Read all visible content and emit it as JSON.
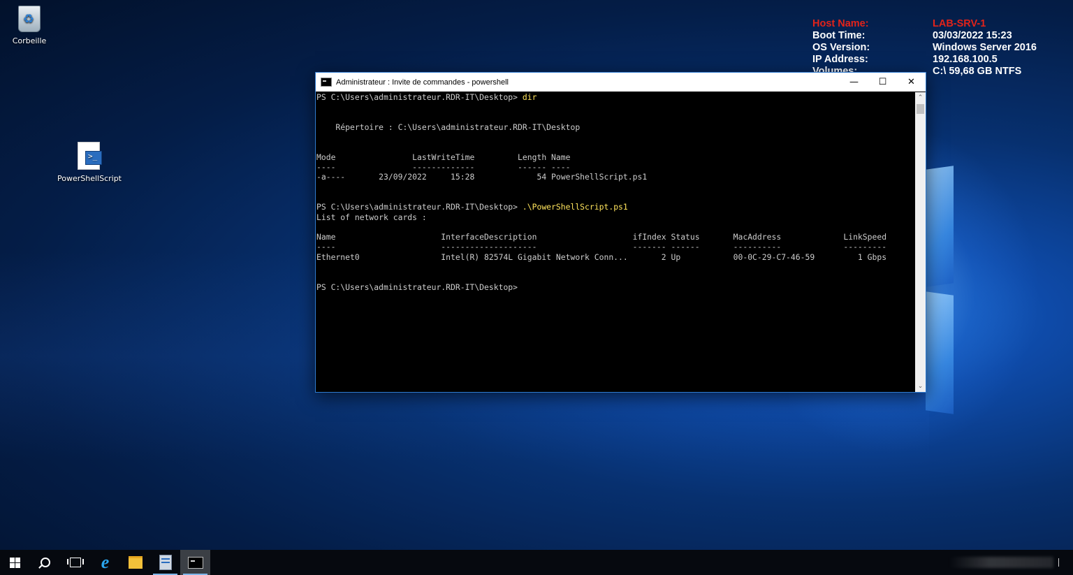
{
  "desktop": {
    "icons": [
      {
        "label": "Corbeille",
        "icon": "recycle-bin-icon"
      },
      {
        "label": "PowerShellScript",
        "icon": "powershell-script-icon"
      }
    ]
  },
  "bginfo": {
    "host_label": "Host Name:",
    "host_value": "LAB-SRV-1",
    "boot_label": "Boot Time:",
    "boot_value": "03/03/2022 15:23",
    "os_label": "OS Version:",
    "os_value": "Windows Server 2016",
    "ip_label": "IP Address:",
    "ip_value": "192.168.100.5",
    "vol_label": "Volumes:",
    "vol_value": "C:\\ 59,68 GB NTFS",
    "accent_color": "#e2231a"
  },
  "window": {
    "title": "Administrateur : Invite de commandes - powershell",
    "controls": {
      "minimize": "—",
      "maximize": "☐",
      "close": "✕"
    },
    "scroll_up": "⌃",
    "scroll_down": "⌄",
    "console": {
      "prompt1": "PS C:\\Users\\administrateur.RDR-IT\\Desktop> ",
      "cmd1": "dir",
      "dir_header": "    Répertoire : C:\\Users\\administrateur.RDR-IT\\Desktop",
      "col_header": "Mode                LastWriteTime         Length Name",
      "col_sep": "----                -------------         ------ ----",
      "file_row": "-a----       23/09/2022     15:28             54 PowerShellScript.ps1",
      "prompt2": "PS C:\\Users\\administrateur.RDR-IT\\Desktop> ",
      "cmd2": ".\\PowerShellScript.ps1",
      "list_title": "List of network cards :",
      "net_header": "Name                      InterfaceDescription                    ifIndex Status       MacAddress             LinkSpeed",
      "net_sep": "----                      --------------------                    ------- ------       ----------             ---------",
      "net_row": "Ethernet0                 Intel(R) 82574L Gigabit Network Conn...       2 Up           00-0C-29-C7-46-59         1 Gbps",
      "prompt3": "PS C:\\Users\\administrateur.RDR-IT\\Desktop>"
    }
  },
  "taskbar": {
    "items": [
      "start-icon",
      "search-icon",
      "task-view-icon",
      "internet-explorer-icon",
      "file-explorer-icon",
      "server-manager-icon",
      "command-prompt-icon"
    ],
    "active": "command-prompt-icon"
  }
}
